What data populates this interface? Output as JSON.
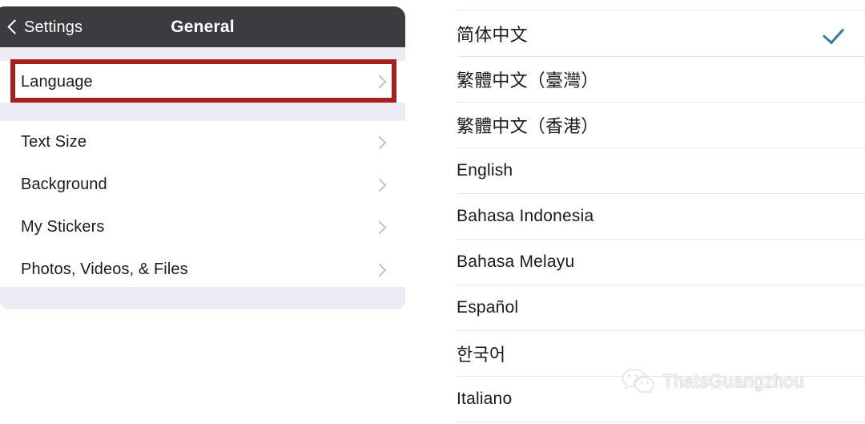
{
  "left_pane": {
    "nav": {
      "back_label": "Settings",
      "back_icon": "chevron-left-icon",
      "title": "General",
      "background_color": "#3c3b40",
      "text_color": "#ffffff"
    },
    "highlight": {
      "color": "#a52121",
      "target": "Language"
    },
    "rows": [
      {
        "label": "Language",
        "accessory_icon": "chevron-right-icon"
      },
      {
        "label": "Text Size",
        "accessory_icon": "chevron-right-icon"
      },
      {
        "label": "Background",
        "accessory_icon": "chevron-right-icon"
      },
      {
        "label": "My Stickers",
        "accessory_icon": "chevron-right-icon"
      },
      {
        "label": "Photos, Videos, & Files",
        "accessory_icon": "chevron-right-icon"
      }
    ]
  },
  "right_pane": {
    "selected_color": "#2f7d99",
    "check_icon": "checkmark-icon",
    "languages": [
      {
        "label": "简体中文",
        "selected": true
      },
      {
        "label": "繁體中文（臺灣）",
        "selected": false
      },
      {
        "label": "繁體中文（香港）",
        "selected": false
      },
      {
        "label": "English",
        "selected": false
      },
      {
        "label": "Bahasa Indonesia",
        "selected": false
      },
      {
        "label": "Bahasa Melayu",
        "selected": false
      },
      {
        "label": "Español",
        "selected": false
      },
      {
        "label": "한국어",
        "selected": false
      },
      {
        "label": "Italiano",
        "selected": false
      }
    ]
  },
  "watermark": {
    "text": "ThatsGuangzhou",
    "icon": "wechat-logo-icon",
    "color": "#f2f2f4"
  }
}
